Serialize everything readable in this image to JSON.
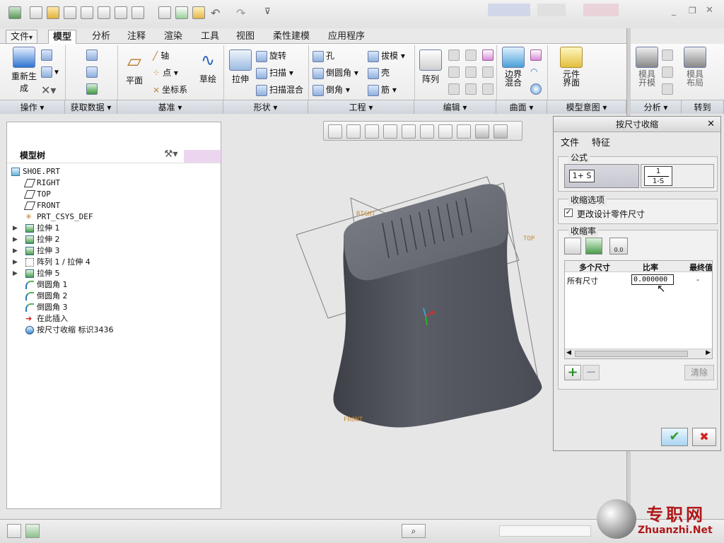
{
  "ribbon_tabs": [
    {
      "label": "文件",
      "dropdown": "▾"
    },
    {
      "label": "模型"
    },
    {
      "label": "分析"
    },
    {
      "label": "注释"
    },
    {
      "label": "渲染"
    },
    {
      "label": "工具"
    },
    {
      "label": "视图"
    },
    {
      "label": "柔性建模"
    },
    {
      "label": "应用程序"
    }
  ],
  "groups": {
    "operations": {
      "label": "操作",
      "regen": "重新生成",
      "regen_line2": "成"
    },
    "get_data": {
      "label": "获取数据"
    },
    "datum": {
      "label": "基准",
      "plane": "平面",
      "axis": "轴",
      "point": "点",
      "csys": "坐标系",
      "sketch": "草绘"
    },
    "shapes": {
      "label": "形状",
      "extrude": "拉伸",
      "revolve": "旋转",
      "sweep": "扫描",
      "swept_blend": "扫描混合"
    },
    "engineering": {
      "label": "工程",
      "hole": "孔",
      "draft": "拔模",
      "round": "倒圆角",
      "shell": "壳",
      "chamfer": "倒角",
      "rib": "筋"
    },
    "editing": {
      "label": "编辑",
      "pattern": "阵列"
    },
    "surfaces": {
      "label": "曲面",
      "boundary": "边界",
      "boundary_line2": "混合"
    },
    "model_intent": {
      "label": "模型意图",
      "component": "元件",
      "component_line2": "界面"
    },
    "analysis": {
      "label": "分析",
      "mold_open": "模具",
      "mold_open_line2": "开模",
      "mold_layout": "模具",
      "mold_layout_line2": "布局"
    },
    "goto": {
      "label": "转到"
    }
  },
  "model_tree": {
    "title": "模型树",
    "items": [
      {
        "label": "SHOE.PRT",
        "expandable": false,
        "indent": 0,
        "icon": "part-icon"
      },
      {
        "label": "RIGHT",
        "expandable": false,
        "indent": 1,
        "icon": "datum-plane-icon"
      },
      {
        "label": "TOP",
        "expandable": false,
        "indent": 1,
        "icon": "datum-plane-icon"
      },
      {
        "label": "FRONT",
        "expandable": false,
        "indent": 1,
        "icon": "datum-plane-icon"
      },
      {
        "label": "PRT_CSYS_DEF",
        "expandable": false,
        "indent": 1,
        "icon": "csys-icon"
      },
      {
        "label": "拉伸 1",
        "expandable": true,
        "indent": 1,
        "icon": "extrude-icon"
      },
      {
        "label": "拉伸 2",
        "expandable": true,
        "indent": 1,
        "icon": "extrude-icon"
      },
      {
        "label": "拉伸 3",
        "expandable": true,
        "indent": 1,
        "icon": "extrude-icon"
      },
      {
        "label": "阵列 1 / 拉伸 4",
        "expandable": true,
        "indent": 1,
        "icon": "pattern-icon"
      },
      {
        "label": "拉伸 5",
        "expandable": true,
        "indent": 1,
        "icon": "extrude-icon"
      },
      {
        "label": "倒圆角 1",
        "expandable": false,
        "indent": 1,
        "icon": "round-icon"
      },
      {
        "label": "倒圆角 2",
        "expandable": false,
        "indent": 1,
        "icon": "round-icon"
      },
      {
        "label": "倒圆角 3",
        "expandable": false,
        "indent": 1,
        "icon": "round-icon"
      },
      {
        "label": "在此插入",
        "expandable": false,
        "indent": 1,
        "icon": "insert-here-arrow-icon"
      },
      {
        "label": "按尺寸收缩 标识3436",
        "expandable": false,
        "indent": 1,
        "icon": "shrink-icon"
      }
    ]
  },
  "viewport": {
    "datum_labels": {
      "right": "RIGHT",
      "top": "TOP",
      "front": "FRONT"
    }
  },
  "dialog": {
    "title": "按尺寸收缩",
    "menu": [
      "文件",
      "特征"
    ],
    "formula": {
      "label": "公式",
      "option1": "1+ S",
      "option2_num": "1",
      "option2_den": "1-S",
      "selected": "1+ S"
    },
    "shrink_options": {
      "label": "收缩选项",
      "checkbox_label": "更改设计零件尺寸",
      "checked": true
    },
    "shrink_rate": {
      "label": "收缩率",
      "columns": [
        "多个尺寸",
        "比率",
        "最终值"
      ],
      "rows": [
        {
          "dimension": "所有尺寸",
          "ratio": "0.000000",
          "final": "-"
        }
      ]
    },
    "clear_label": "清除",
    "ok_symbol": "✔",
    "cancel_symbol": "✖"
  },
  "watermark": {
    "cn": "专职网",
    "en": "Zhuanzhi.Net"
  },
  "colors": {
    "ok": "#3fae3f",
    "cancel": "#d42020",
    "model": "#55575f",
    "datum": "#c68a3c"
  }
}
